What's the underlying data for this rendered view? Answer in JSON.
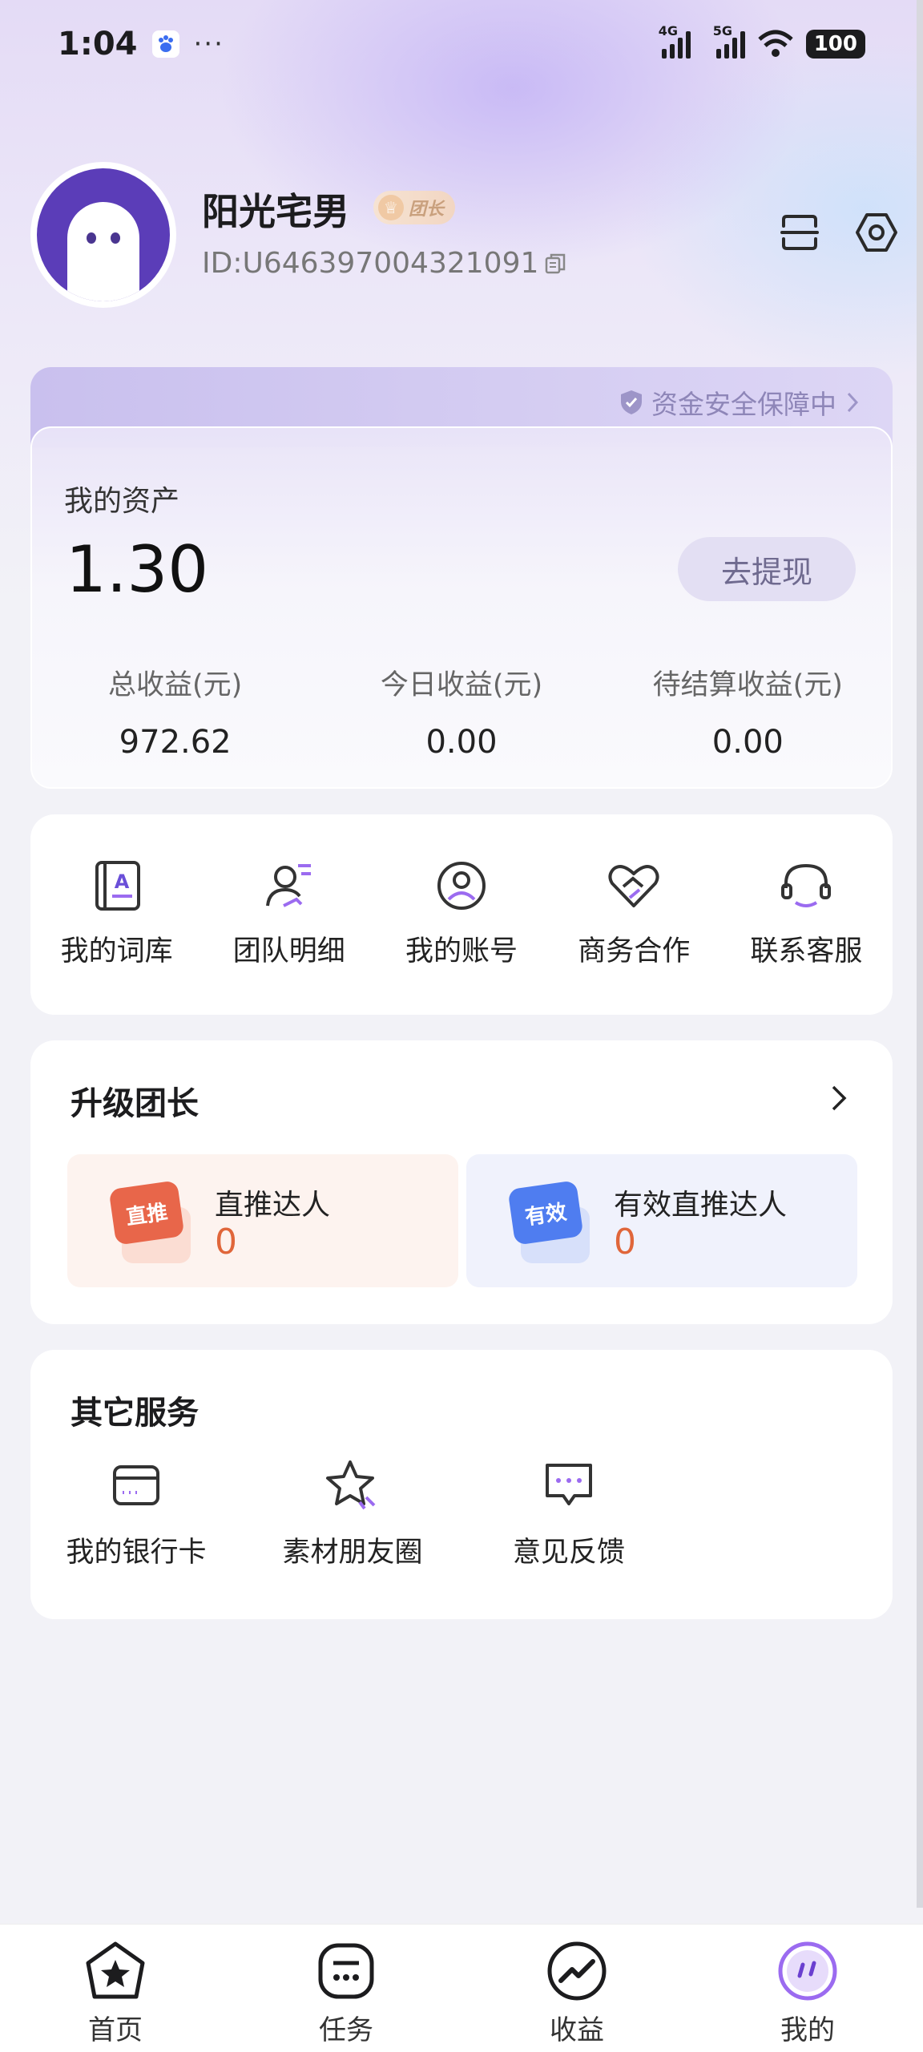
{
  "status_bar": {
    "time": "1:04",
    "dots": "···",
    "net1": "4G",
    "net2": "5G",
    "battery": "100"
  },
  "profile": {
    "name": "阳光宅男",
    "badge": "团长",
    "id": "ID:U646397004321091"
  },
  "assets": {
    "safety_text": "资金安全保障中",
    "label": "我的资产",
    "value": "1.30",
    "withdraw_label": "去提现",
    "stats": [
      {
        "label": "总收益(元)",
        "value": "972.62"
      },
      {
        "label": "今日收益(元)",
        "value": "0.00"
      },
      {
        "label": "待结算收益(元)",
        "value": "0.00"
      }
    ]
  },
  "quick_links": [
    {
      "label": "我的词库",
      "icon": "book-icon"
    },
    {
      "label": "团队明细",
      "icon": "team-icon"
    },
    {
      "label": "我的账号",
      "icon": "account-icon"
    },
    {
      "label": "商务合作",
      "icon": "handshake-heart-icon"
    },
    {
      "label": "联系客服",
      "icon": "headset-icon"
    }
  ],
  "upgrade": {
    "title": "升级团长",
    "items": [
      {
        "icon_text": "直推",
        "title": "直推达人",
        "value": "0"
      },
      {
        "icon_text": "有效",
        "title": "有效直推达人",
        "value": "0"
      }
    ]
  },
  "services": {
    "title": "其它服务",
    "items": [
      {
        "label": "我的银行卡",
        "icon": "bank-card-icon"
      },
      {
        "label": "素材朋友圈",
        "icon": "star-icon"
      },
      {
        "label": "意见反馈",
        "icon": "feedback-icon"
      }
    ]
  },
  "nav": [
    {
      "label": "首页",
      "icon": "home-star-icon"
    },
    {
      "label": "任务",
      "icon": "task-icon"
    },
    {
      "label": "收益",
      "icon": "earnings-icon"
    },
    {
      "label": "我的",
      "icon": "profile-icon",
      "active": true
    }
  ],
  "colors": {
    "accent": "#9b6bf0",
    "value_orange": "#e0663a",
    "direct_icon": "#e8664a",
    "valid_icon": "#4f7df0"
  }
}
